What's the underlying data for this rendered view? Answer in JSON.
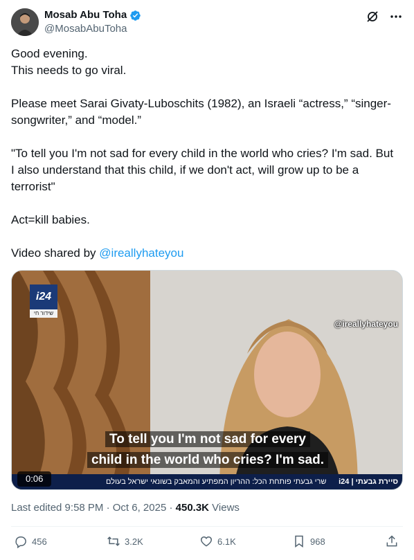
{
  "author": {
    "display_name": "Mosab Abu Toha",
    "handle": "@MosabAbuToha",
    "verified_color": "#1d9bf0"
  },
  "tweet": {
    "paragraphs": [
      [
        "Good evening.",
        "This needs to go viral."
      ],
      [
        "Please meet Sarai Givaty-Luboschits (1982), an Israeli “actress,” “singer-",
        "songwriter,” and “model.”"
      ],
      [
        "\"To tell you I'm not sad for every child in the world who cries? I'm sad. But",
        "I also understand that this child, if we don't act, will grow up to be a",
        "terrorist\""
      ],
      [
        "Act=kill babies."
      ]
    ],
    "video_credit_prefix": "Video shared by ",
    "video_credit_link": "@ireallyhateyou"
  },
  "media": {
    "channel_logo": "i24",
    "live_tag": "שידור חי",
    "watermark": "@ireallyhateyou",
    "subtitle_line1": "To tell you I'm not sad for every",
    "subtitle_line2": "child in the world who cries? I'm sad.",
    "ticker_text": "שרי גבעתי פותחת הכל: ההריון המפתיע והמאבק בשונאי ישראל בעולם",
    "ticker_brand": "סיירת גבעתי | i24",
    "time": "0:06"
  },
  "meta": {
    "edited": "Last edited 9:58 PM · Oct 6, 2025 · ",
    "views_count": "450.3K",
    "views_label": " Views"
  },
  "actions": {
    "replies": "456",
    "reposts": "3.2K",
    "likes": "6.1K",
    "bookmarks": "968"
  },
  "colors": {
    "text": "#0f1419",
    "secondary": "#536471",
    "link": "#1d9bf0"
  }
}
